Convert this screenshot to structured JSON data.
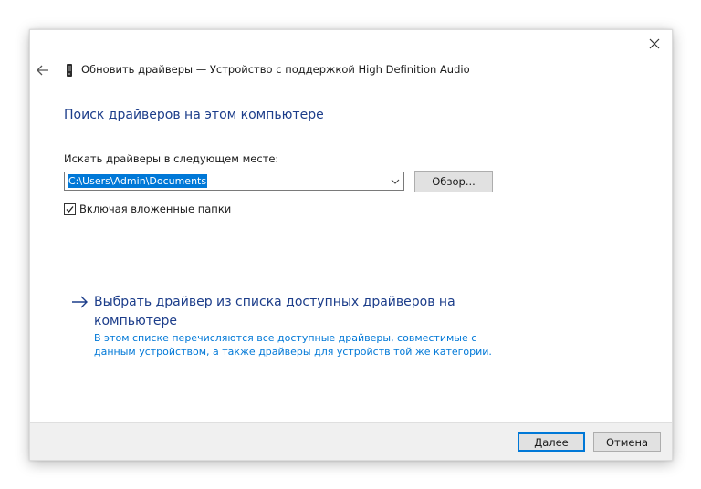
{
  "window": {
    "title": "Обновить драйверы — Устройство с поддержкой High Definition Audio"
  },
  "page": {
    "heading": "Поиск драйверов на этом компьютере",
    "search_label": "Искать драйверы в следующем месте:",
    "path_value": "C:\\Users\\Admin\\Documents",
    "browse_label": "Обзор...",
    "include_subfolders_label": "Включая вложенные папки",
    "include_subfolders_checked": true
  },
  "pick_option": {
    "link_text": "Выбрать драйвер из списка доступных драйверов на компьютере",
    "description": "В этом списке перечисляются все доступные драйверы, совместимые с данным устройством, а также драйверы для устройств той же категории."
  },
  "footer": {
    "next_label": "Далее",
    "cancel_label": "Отмена"
  },
  "icons": {
    "close": "close-icon",
    "back": "back-arrow-icon",
    "device": "device-icon",
    "dropdown": "chevron-down-icon",
    "checkbox": "checkmark-icon",
    "link_arrow": "arrow-right-icon"
  },
  "colors": {
    "heading": "#1c3d8a",
    "accent": "#0078d7",
    "footer_bg": "#f0f0f0"
  }
}
